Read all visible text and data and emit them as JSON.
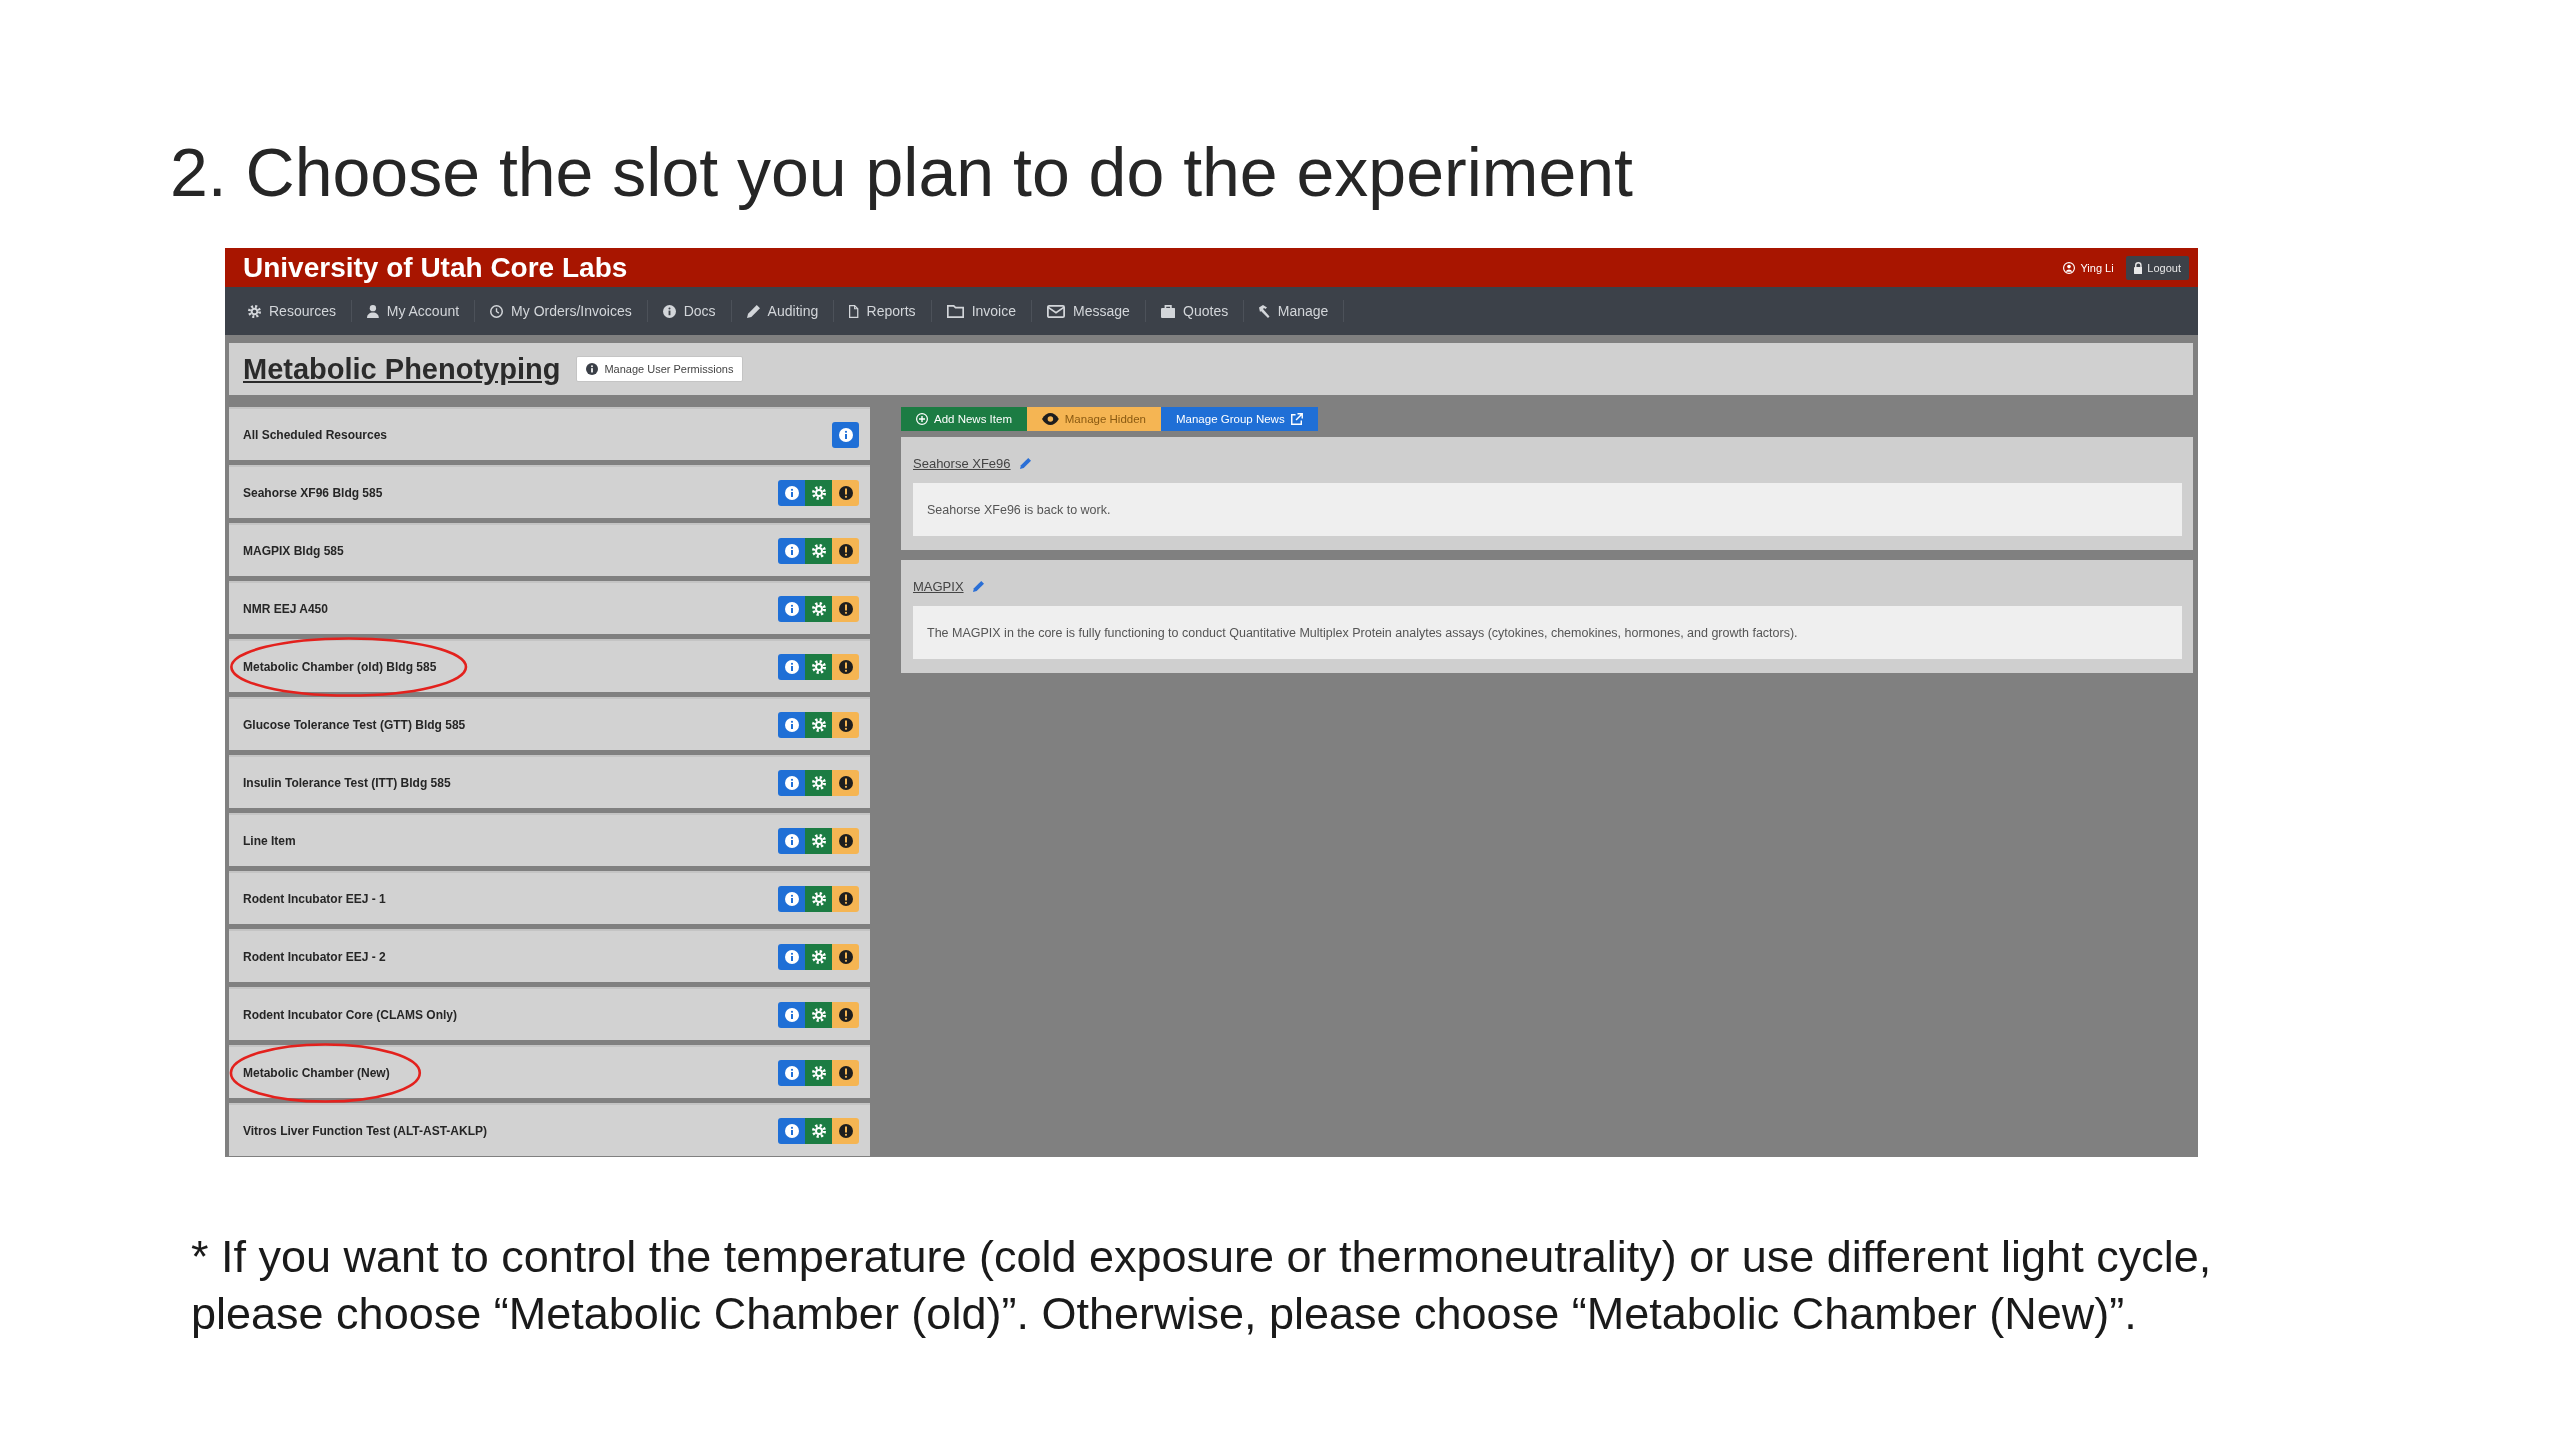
{
  "slide_title": "2. Choose the slot you plan to do the experiment",
  "app": {
    "header": {
      "title": "University of Utah Core Labs",
      "user": "Ying Li",
      "logout": "Logout"
    },
    "nav": [
      "Resources",
      "My Account",
      "My Orders/Invoices",
      "Docs",
      "Auditing",
      "Reports",
      "Invoice",
      "Message",
      "Quotes",
      "Manage"
    ],
    "page": {
      "title": "Metabolic Phenotyping",
      "permissions_button": "Manage User Permissions"
    },
    "resources": [
      {
        "name": "All Scheduled Resources",
        "buttons": [
          {
            "kind": "info"
          }
        ],
        "highlighted": false
      },
      {
        "name": "Seahorse XF96 Bldg 585",
        "buttons": [
          {
            "kind": "info"
          },
          {
            "kind": "settings"
          },
          {
            "kind": "alert"
          }
        ],
        "highlighted": false
      },
      {
        "name": "MAGPIX Bldg 585",
        "buttons": [
          {
            "kind": "info"
          },
          {
            "kind": "settings"
          },
          {
            "kind": "alert"
          }
        ],
        "highlighted": false
      },
      {
        "name": "NMR EEJ A450",
        "buttons": [
          {
            "kind": "info"
          },
          {
            "kind": "settings"
          },
          {
            "kind": "alert"
          }
        ],
        "highlighted": false
      },
      {
        "name": "Metabolic Chamber (old) Bldg 585",
        "buttons": [
          {
            "kind": "info"
          },
          {
            "kind": "settings"
          },
          {
            "kind": "alert"
          }
        ],
        "highlighted": true
      },
      {
        "name": "Glucose Tolerance Test (GTT) Bldg 585",
        "buttons": [
          {
            "kind": "info"
          },
          {
            "kind": "settings"
          },
          {
            "kind": "alert"
          }
        ],
        "highlighted": false
      },
      {
        "name": "Insulin Tolerance Test (ITT) Bldg 585",
        "buttons": [
          {
            "kind": "info"
          },
          {
            "kind": "settings"
          },
          {
            "kind": "alert"
          }
        ],
        "highlighted": false
      },
      {
        "name": "Line Item",
        "buttons": [
          {
            "kind": "info"
          },
          {
            "kind": "settings"
          },
          {
            "kind": "alert"
          }
        ],
        "highlighted": false
      },
      {
        "name": "Rodent Incubator EEJ - 1",
        "buttons": [
          {
            "kind": "info"
          },
          {
            "kind": "settings"
          },
          {
            "kind": "alert"
          }
        ],
        "highlighted": false
      },
      {
        "name": "Rodent Incubator EEJ - 2",
        "buttons": [
          {
            "kind": "info"
          },
          {
            "kind": "settings"
          },
          {
            "kind": "alert"
          }
        ],
        "highlighted": false
      },
      {
        "name": "Rodent Incubator Core (CLAMS Only)",
        "buttons": [
          {
            "kind": "info"
          },
          {
            "kind": "settings"
          },
          {
            "kind": "alert"
          }
        ],
        "highlighted": false
      },
      {
        "name": "Metabolic Chamber (New)",
        "buttons": [
          {
            "kind": "info"
          },
          {
            "kind": "settings"
          },
          {
            "kind": "alert"
          }
        ],
        "highlighted": true
      },
      {
        "name": "Vitros Liver Function Test (ALT-AST-AKLP)",
        "buttons": [
          {
            "kind": "info"
          },
          {
            "kind": "settings"
          },
          {
            "kind": "alert"
          }
        ],
        "highlighted": false
      }
    ],
    "news_toolbar": [
      {
        "label": "Add News Item",
        "kind": "add"
      },
      {
        "label": "Manage Hidden",
        "kind": "hidden"
      },
      {
        "label": "Manage Group News",
        "kind": "group"
      }
    ],
    "news": [
      {
        "title": "Seahorse XFe96",
        "body": "Seahorse XFe96 is back to work."
      },
      {
        "title": "MAGPIX",
        "body": "The MAGPIX in the core is fully functioning to conduct Quantitative Multiplex Protein analytes assays (cytokines, chemokines, hormones, and growth factors)."
      }
    ]
  },
  "footnote": "* If you want to control the temperature (cold exposure or thermoneutrality) or use different light cycle, please choose “Metabolic Chamber (old)”. Otherwise, please choose “Metabolic Chamber (New)”."
}
